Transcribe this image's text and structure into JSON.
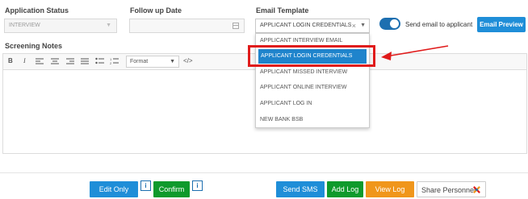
{
  "status": {
    "label": "Application Status",
    "value": "INTERVIEW"
  },
  "followup": {
    "label": "Follow up Date",
    "value": ""
  },
  "email_template": {
    "label": "Email Template",
    "value": "APPLICANT LOGIN CREDENTIALS",
    "clear_glyph": "×",
    "dropdown_glyph": "▼",
    "options": [
      "APPLICANT INTERVIEW EMAIL",
      "APPLICANT LOGIN CREDENTIALS",
      "APPLICANT MISSED INTERVIEW",
      "APPLICANT ONLINE INTERVIEW",
      "APPLICANT LOG IN",
      "NEW BANK BSB"
    ],
    "selected_index": 1
  },
  "send_email": {
    "label": "Send email to applicant",
    "on": true
  },
  "email_preview_label": "Email Preview",
  "screening_notes": {
    "label": "Screening Notes",
    "toolbar": {
      "bold": "B",
      "italic": "I",
      "format_label": "Format",
      "code": "</>"
    },
    "content": ""
  },
  "footer": {
    "edit_only": "Edit Only",
    "confirm": "Confirm",
    "info_glyph": "i",
    "send_sms": "Send SMS",
    "add_log": "Add Log",
    "view_log": "View Log",
    "share_personnel": "Share Personnel"
  },
  "colors": {
    "primary": "#1f8ed8",
    "toggle": "#1d6fb0",
    "confirm": "#0f9a2c",
    "add_log": "#0f9a2c",
    "view_log": "#f0961b",
    "annotation": "#e01b1b"
  }
}
